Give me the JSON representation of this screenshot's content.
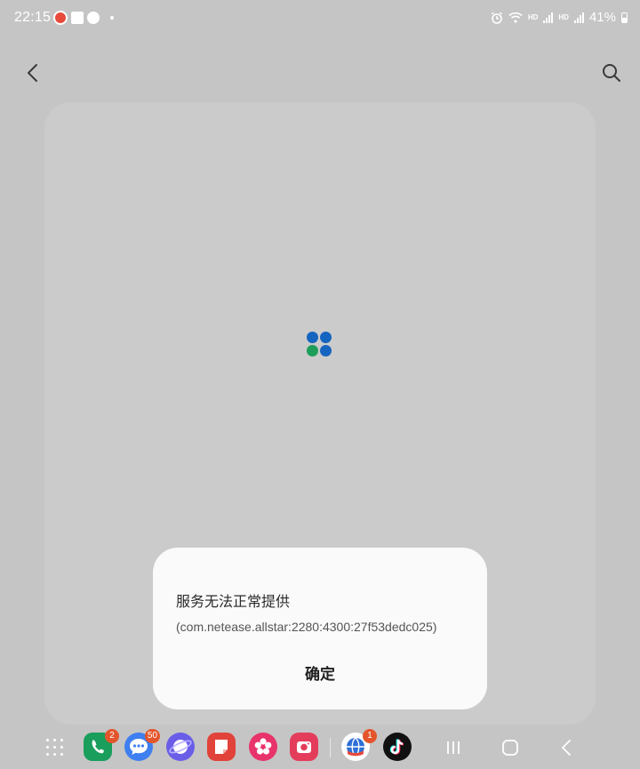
{
  "status_bar": {
    "time": "22:15",
    "battery_percent": "41%",
    "network_label_1": "HD",
    "network_label_2": "HD",
    "icons": [
      "netease-app-icon",
      "gallery-icon",
      "messenger-icon",
      "wifi-icon",
      "alarm-icon",
      "signal-icon",
      "battery-icon"
    ]
  },
  "header": {
    "back_icon": "chevron-left-icon",
    "search_icon": "search-icon"
  },
  "loading": {
    "colors": [
      "#1565c0",
      "#1565c0",
      "#1e9e5a",
      "#1565c0"
    ]
  },
  "dialog": {
    "title": "服务无法正常提供",
    "message": "(com.netease.allstar:2280:4300:27f53dedc025)",
    "confirm_label": "确定"
  },
  "dock": {
    "apps": [
      {
        "name": "phone",
        "color": "#1a9e5c",
        "badge": "2"
      },
      {
        "name": "messages",
        "color": "#3f7ff0",
        "badge": "50"
      },
      {
        "name": "internet",
        "color": "#6a5ee8",
        "badge": ""
      },
      {
        "name": "notes",
        "color": "#e1433b",
        "badge": ""
      },
      {
        "name": "gallery",
        "color": "#e8336b",
        "badge": ""
      },
      {
        "name": "camera",
        "color": "#e43d5c",
        "badge": ""
      },
      {
        "name": "netease-game",
        "color": "#ffffff",
        "badge": "1"
      },
      {
        "name": "tiktok",
        "color": "#111111",
        "badge": ""
      }
    ]
  }
}
